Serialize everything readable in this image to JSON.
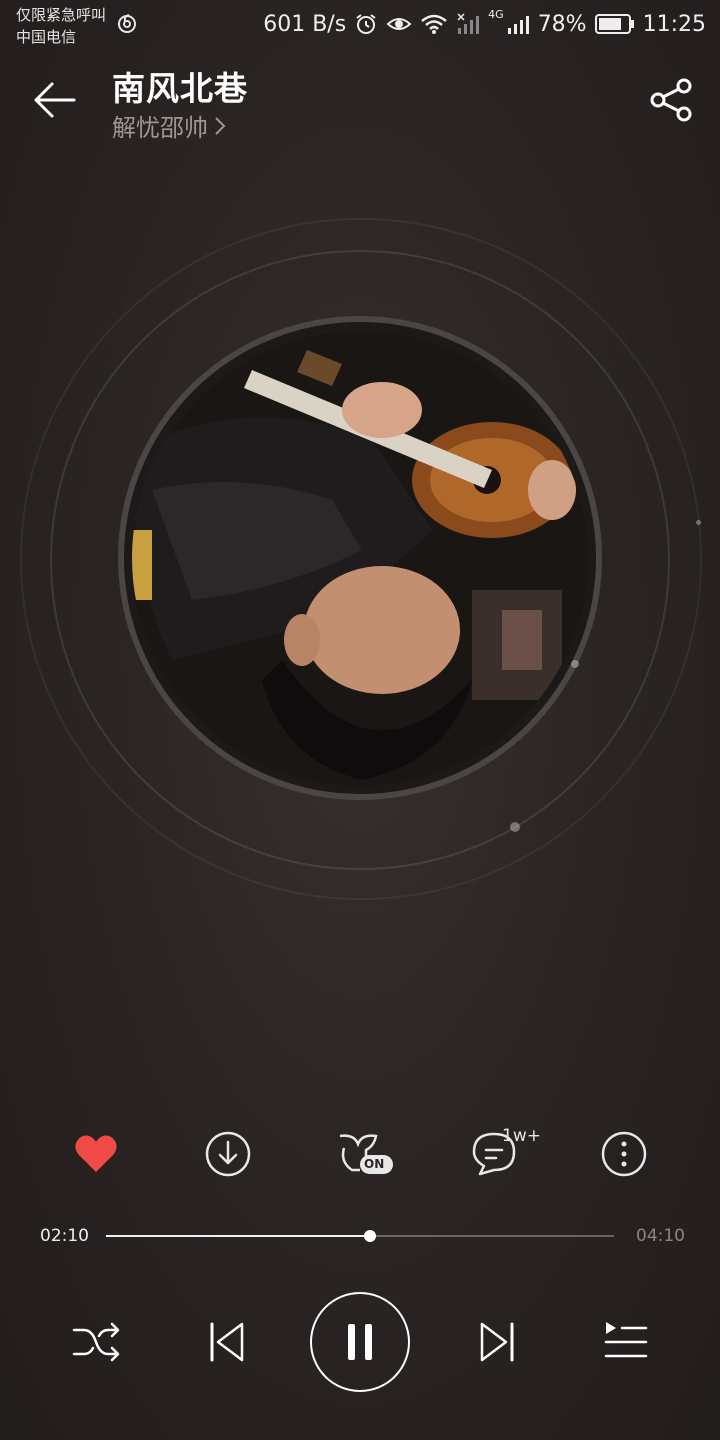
{
  "status_bar": {
    "carrier_line1": "仅限紧急呼叫",
    "carrier_line2": "中国电信",
    "net_speed": "601 B/s",
    "network_type": "4G",
    "battery": "78%",
    "time": "11:25"
  },
  "header": {
    "title": "南风北巷",
    "artist": "解忧邵帅"
  },
  "actions": {
    "comment_badge": "1w+",
    "effect_badge": "ON"
  },
  "progress": {
    "current": "02:10",
    "total": "04:10",
    "fraction": 0.52
  },
  "colors": {
    "like": "#f24a44",
    "accent": "#ffffff",
    "muted": "#9c9694"
  }
}
